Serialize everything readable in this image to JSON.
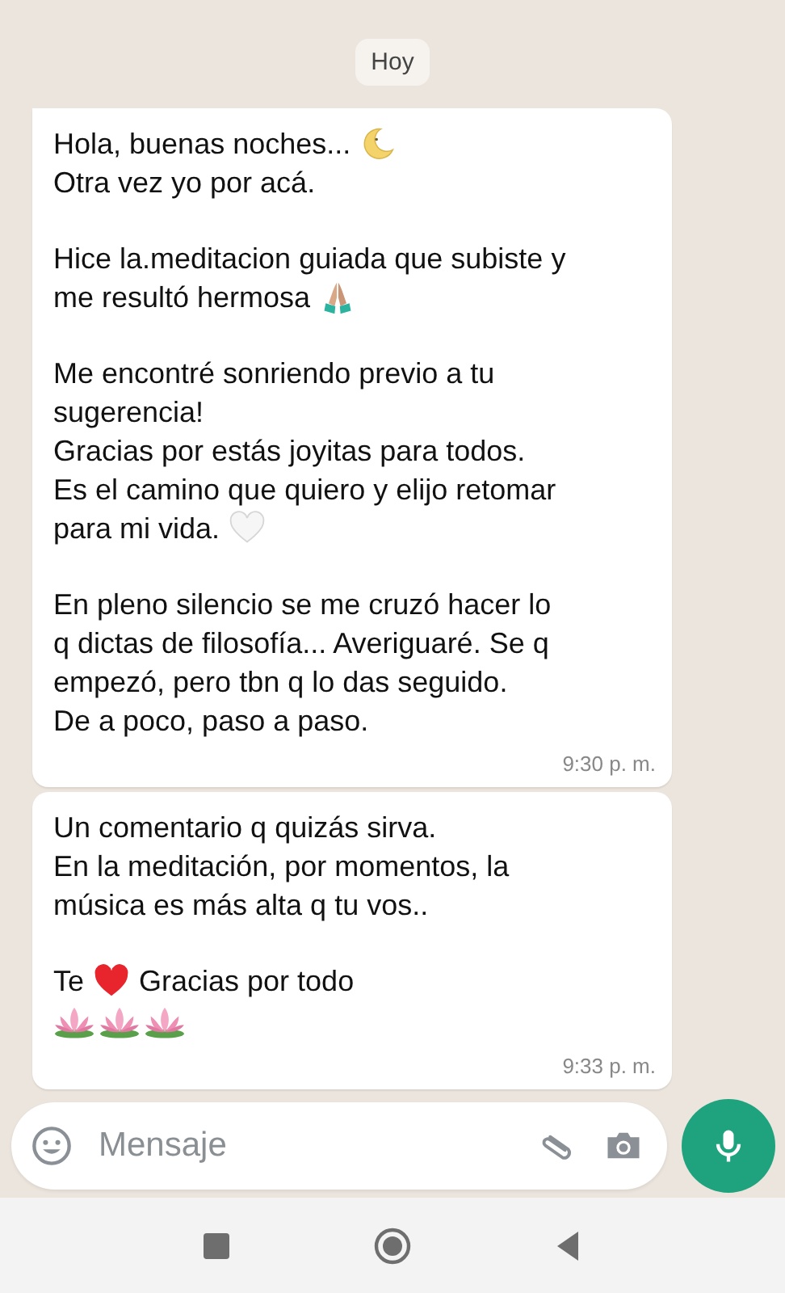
{
  "date_chip": "Hoy",
  "messages": [
    {
      "paragraphs": [
        [
          [
            {
              "kind": "text",
              "text": "Hola, buenas noches..."
            },
            {
              "kind": "moon"
            }
          ],
          [
            {
              "kind": "text",
              "text": "Otra vez yo por acá."
            }
          ]
        ],
        [
          [
            {
              "kind": "text",
              "text": "Hice la.meditacion guiada que subiste y"
            }
          ],
          [
            {
              "kind": "text",
              "text": "me resultó hermosa"
            },
            {
              "kind": "hands"
            }
          ]
        ],
        [
          [
            {
              "kind": "text",
              "text": "Me encontré sonriendo previo a tu"
            }
          ],
          [
            {
              "kind": "text",
              "text": "sugerencia!"
            }
          ],
          [
            {
              "kind": "text",
              "text": "Gracias por estás joyitas para todos."
            }
          ],
          [
            {
              "kind": "text",
              "text": "Es el camino que quiero y elijo retomar"
            }
          ],
          [
            {
              "kind": "text",
              "text": "para mi vida."
            },
            {
              "kind": "whiteheart"
            }
          ]
        ],
        [
          [
            {
              "kind": "text",
              "text": "En pleno silencio se me cruzó hacer lo"
            }
          ],
          [
            {
              "kind": "text",
              "text": "q dictas de filosofía... Averiguaré. Se q"
            }
          ],
          [
            {
              "kind": "text",
              "text": "empezó, pero tbn q lo das seguido."
            }
          ],
          [
            {
              "kind": "text",
              "text": "De a poco, paso a paso."
            }
          ]
        ]
      ],
      "time": "9:30 p. m."
    },
    {
      "paragraphs": [
        [
          [
            {
              "kind": "text",
              "text": "Un comentario q quizás sirva."
            }
          ],
          [
            {
              "kind": "text",
              "text": "En la meditación, por momentos, la"
            }
          ],
          [
            {
              "kind": "text",
              "text": "música es más alta q tu vos.."
            }
          ]
        ],
        [
          [
            {
              "kind": "text",
              "text": "Te"
            },
            {
              "kind": "redheart"
            },
            {
              "kind": "text",
              "text": "Gracias por todo"
            }
          ],
          [
            {
              "kind": "lotus"
            },
            {
              "kind": "lotus"
            },
            {
              "kind": "lotus"
            }
          ]
        ]
      ],
      "time": "9:33 p. m."
    }
  ],
  "composer": {
    "placeholder": "Mensaje"
  }
}
